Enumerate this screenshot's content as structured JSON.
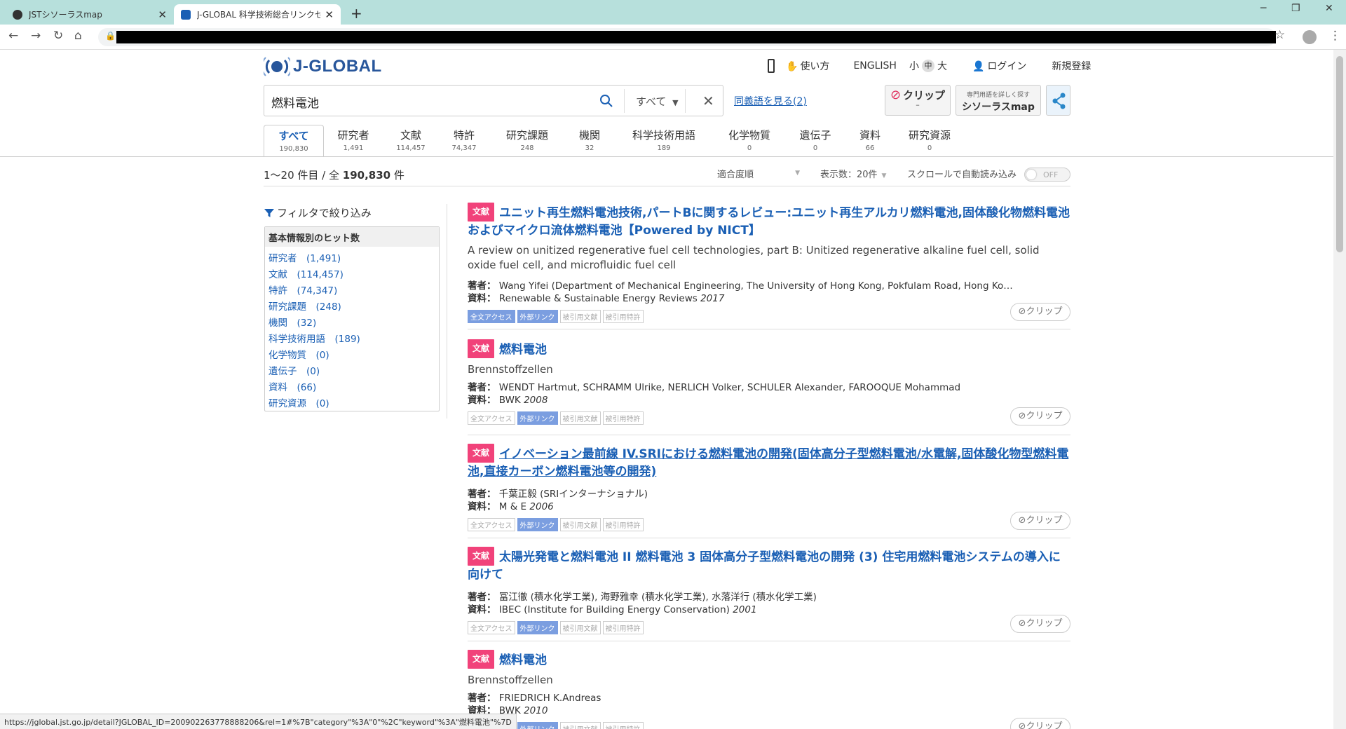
{
  "browser": {
    "tabs": [
      {
        "title": "JSTシソーラスmap",
        "active": false
      },
      {
        "title": "J-GLOBAL 科学技術総合リンクセ",
        "active": true
      }
    ],
    "new_tab": "+",
    "status_url": "https://jglobal.jst.go.jp/detail?JGLOBAL_ID=200902263778888206&rel=1#%7B\"category\"%3A\"0\"%2C\"keyword\"%3A\"燃料電池\"%7D"
  },
  "header": {
    "logo_text": "J-GLOBAL",
    "util_nav": {
      "howto": "使い方",
      "english": "ENGLISH",
      "small": "小",
      "font_mid": "中",
      "large": "大",
      "login": "ログイン",
      "register": "新規登録"
    },
    "search": {
      "query": "燃料電池",
      "scope": "すべて"
    },
    "synonym_link": "同義語を見る(2)",
    "clip_button": {
      "label": "クリップ",
      "count": "–"
    },
    "thesaurus_button": {
      "caption": "専門用語を詳しく探す",
      "label": "シソーラスmap"
    }
  },
  "category_tabs": [
    {
      "label": "すべて",
      "count": "190,830",
      "active": true
    },
    {
      "label": "研究者",
      "count": "1,491"
    },
    {
      "label": "文献",
      "count": "114,457"
    },
    {
      "label": "特許",
      "count": "74,347"
    },
    {
      "label": "研究課題",
      "count": "248"
    },
    {
      "label": "機関",
      "count": "32"
    },
    {
      "label": "科学技術用語",
      "count": "189"
    },
    {
      "label": "化学物質",
      "count": "0"
    },
    {
      "label": "遺伝子",
      "count": "0"
    },
    {
      "label": "資料",
      "count": "66"
    },
    {
      "label": "研究資源",
      "count": "0"
    }
  ],
  "results_header": {
    "range": "1〜20 件目 / 全",
    "total": "190,830",
    "unit": "件",
    "sort": "適合度順",
    "page_size": "表示数：20件",
    "autoload_label": "スクロールで自動読み込み",
    "toggle": "OFF"
  },
  "sidebar": {
    "filter_title": "フィルタで絞り込み",
    "box_header": "基本情報別のヒット数",
    "items": [
      "研究者　(1,491)",
      "文献　(114,457)",
      "特許　(74,347)",
      "研究課題　(248)",
      "機関　(32)",
      "科学技術用語　(189)",
      "化学物質　(0)",
      "遺伝子　(0)",
      "資料　(66)",
      "研究資源　(0)"
    ]
  },
  "labels": {
    "author": "著者：",
    "source": "資料：",
    "clip": "クリップ"
  },
  "tag_labels": [
    "全文アクセス",
    "外部リンク",
    "被引用文献",
    "被引用特許"
  ],
  "results": [
    {
      "badge": "文献",
      "title": "ユニット再生燃料電池技術,パートBに関するレビュー:ユニット再生アルカリ燃料電池,固体酸化物燃料電池およびマイクロ流体燃料電池【Powered by NICT】",
      "subtitle": "A review on unitized regenerative fuel cell technologies, part B: Unitized regenerative alkaline fuel cell, solid oxide fuel cell, and microfluidic fuel cell",
      "author": "Wang Yifei (Department of Mechanical Engineering, The University of Hong Kong, Pokfulam Road, Hong Ko…",
      "source": "Renewable & Sustainable Energy Reviews",
      "year": "2017"
    },
    {
      "badge": "文献",
      "title": "燃料電池",
      "subtitle": "Brennstoffzellen",
      "author": "WENDT Hartmut, SCHRAMM Ulrike, NERLICH Volker, SCHULER Alexander, FAROOQUE Mohammad",
      "source": "BWK",
      "year": "2008"
    },
    {
      "badge": "文献",
      "title": "イノベーション最前線 IV.SRIにおける燃料電池の開発(固体高分子型燃料電池/水電解,固体酸化物型燃料電池,直接カーボン燃料電池等の開発)",
      "author": "千葉正毅 (SRIインターナショナル)",
      "source": "M & E",
      "year": "2006"
    },
    {
      "badge": "文献",
      "title": "太陽光発電と燃料電池 II 燃料電池 3 固体高分子型燃料電池の開発 (3) 住宅用燃料電池システムの導入に向けて",
      "author": "冨江徹 (積水化学工業), 海野雅幸 (積水化学工業), 水落洋行 (積水化学工業)",
      "source": "IBEC (Institute for Building Energy Conservation)",
      "year": "2001"
    },
    {
      "badge": "文献",
      "title": "燃料電池",
      "subtitle": "Brennstoffzellen",
      "author": "FRIEDRICH K.Andreas",
      "source": "BWK",
      "year": "2010"
    }
  ],
  "colors": {
    "accent": "#1a5fb4",
    "badge": "#f1427a",
    "tag_on": "#7b9ee0",
    "tabbar": "#b7e0dc",
    "logo": "#28569b"
  }
}
